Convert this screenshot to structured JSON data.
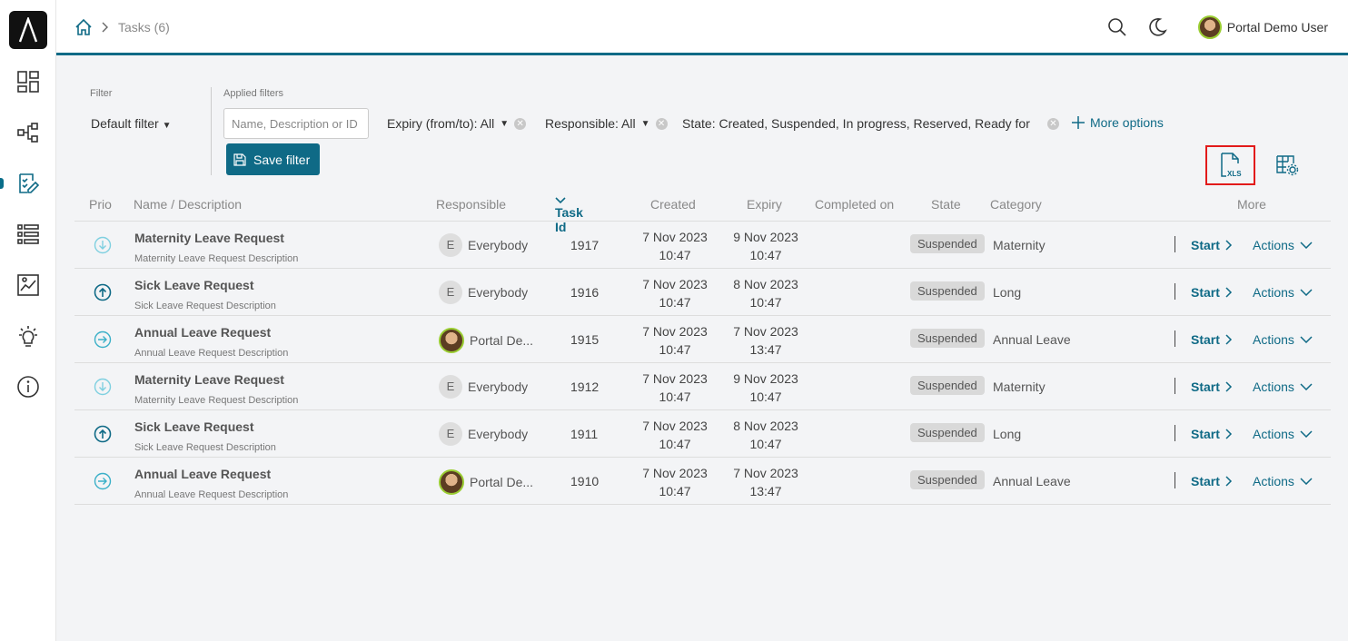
{
  "breadcrumb": {
    "current": "Tasks (6)"
  },
  "header": {
    "user_name": "Portal Demo User"
  },
  "filter": {
    "filter_label": "Filter",
    "default_filter": "Default filter",
    "applied_label": "Applied filters",
    "search_placeholder": "Name, Description or ID",
    "save_label": "Save filter",
    "expiry": "Expiry (from/to): All",
    "responsible": "Responsible: All",
    "state": "State: Created, Suspended, In progress, Reserved, Ready for jo",
    "more_options": "More options"
  },
  "table": {
    "headers": {
      "prio": "Prio",
      "name": "Name / Description",
      "responsible": "Responsible",
      "task_id": "Task Id",
      "created": "Created",
      "expiry": "Expiry",
      "completed": "Completed on",
      "state": "State",
      "category": "Category",
      "more": "More"
    },
    "rows": [
      {
        "prio": "low",
        "name": "Maternity Leave Request",
        "desc": "Maternity Leave Request Description",
        "responsible_initial": "E",
        "responsible": "Everybody",
        "id": "1917",
        "created_date": "7 Nov 2023",
        "created_time": "10:47",
        "expiry_date": "9 Nov 2023",
        "expiry_time": "10:47",
        "state": "Suspended",
        "category": "Maternity",
        "start": "Start",
        "actions": "Actions"
      },
      {
        "prio": "high",
        "name": "Sick Leave Request",
        "desc": "Sick Leave Request Description",
        "responsible_initial": "E",
        "responsible": "Everybody",
        "id": "1916",
        "created_date": "7 Nov 2023",
        "created_time": "10:47",
        "expiry_date": "8 Nov 2023",
        "expiry_time": "10:47",
        "state": "Suspended",
        "category": "Long",
        "start": "Start",
        "actions": "Actions"
      },
      {
        "prio": "normal",
        "name": "Annual Leave Request",
        "desc": "Annual Leave Request Description",
        "responsible_initial": "",
        "responsible": "Portal De...",
        "id": "1915",
        "created_date": "7 Nov 2023",
        "created_time": "10:47",
        "expiry_date": "7 Nov 2023",
        "expiry_time": "13:47",
        "state": "Suspended",
        "category": "Annual Leave",
        "start": "Start",
        "actions": "Actions"
      },
      {
        "prio": "low",
        "name": "Maternity Leave Request",
        "desc": "Maternity Leave Request Description",
        "responsible_initial": "E",
        "responsible": "Everybody",
        "id": "1912",
        "created_date": "7 Nov 2023",
        "created_time": "10:47",
        "expiry_date": "9 Nov 2023",
        "expiry_time": "10:47",
        "state": "Suspended",
        "category": "Maternity",
        "start": "Start",
        "actions": "Actions"
      },
      {
        "prio": "high",
        "name": "Sick Leave Request",
        "desc": "Sick Leave Request Description",
        "responsible_initial": "E",
        "responsible": "Everybody",
        "id": "1911",
        "created_date": "7 Nov 2023",
        "created_time": "10:47",
        "expiry_date": "8 Nov 2023",
        "expiry_time": "10:47",
        "state": "Suspended",
        "category": "Long",
        "start": "Start",
        "actions": "Actions"
      },
      {
        "prio": "normal",
        "name": "Annual Leave Request",
        "desc": "Annual Leave Request Description",
        "responsible_initial": "",
        "responsible": "Portal De...",
        "id": "1910",
        "created_date": "7 Nov 2023",
        "created_time": "10:47",
        "expiry_date": "7 Nov 2023",
        "expiry_time": "13:47",
        "state": "Suspended",
        "category": "Annual Leave",
        "start": "Start",
        "actions": "Actions"
      }
    ]
  },
  "icons": {
    "sidebar": [
      "dashboard-icon",
      "process-icon",
      "task-icon",
      "case-list-icon",
      "statistics-icon",
      "idea-icon",
      "info-icon"
    ],
    "toolbar": [
      "search-icon",
      "dark-mode-icon",
      "export-xls-icon",
      "column-settings-icon"
    ]
  },
  "colors": {
    "accent": "#0f6a86",
    "highlight_box": "#e21a1a",
    "badge_bg": "#d9d9d9"
  }
}
